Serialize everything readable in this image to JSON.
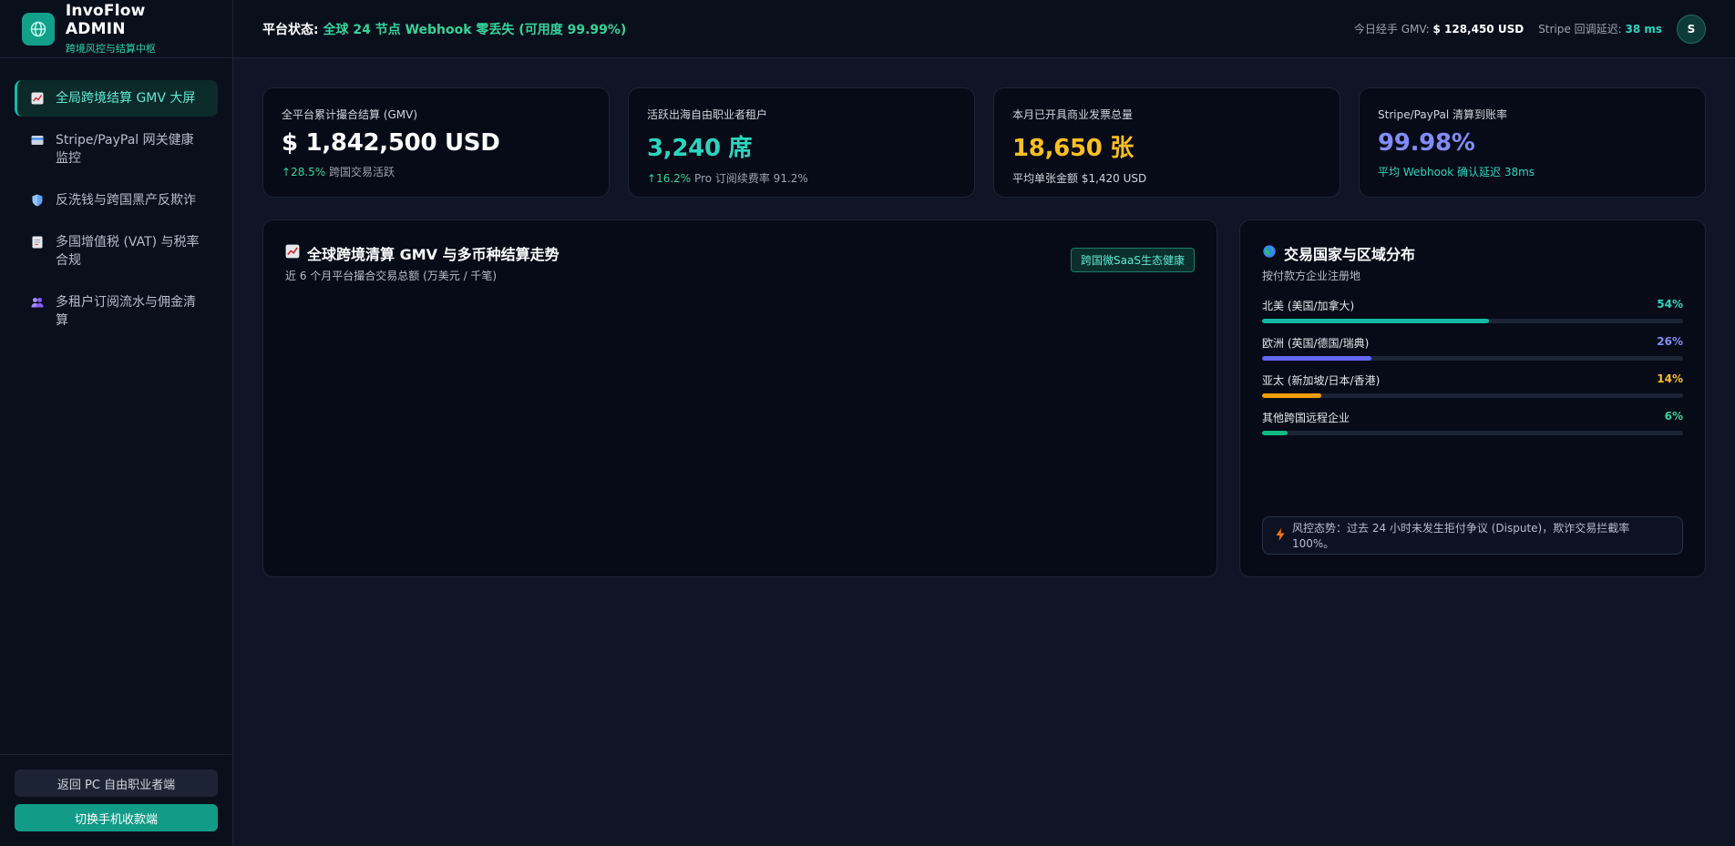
{
  "brand": {
    "name": "InvoFlow ADMIN",
    "subtitle": "跨境风控与结算中枢"
  },
  "nav": {
    "items": [
      {
        "label": "全局跨境结算 GMV 大屏",
        "icon": "chart-icon",
        "active": true
      },
      {
        "label": "Stripe/PayPal 网关健康监控",
        "icon": "card-icon",
        "active": false
      },
      {
        "label": "反洗钱与跨国黑产反欺诈",
        "icon": "shield-icon",
        "active": false
      },
      {
        "label": "多国增值税 (VAT) 与税率合规",
        "icon": "document-icon",
        "active": false
      },
      {
        "label": "多租户订阅流水与佣金清算",
        "icon": "users-icon",
        "active": false
      }
    ]
  },
  "footer": {
    "back_label": "返回 PC 自由职业者端",
    "mobile_label": "切换手机收款端"
  },
  "topbar": {
    "status_label": "平台状态:",
    "status_value": "全球 24 节点 Webhook 零丢失 (可用度 99.99%)",
    "gmv_label": "今日经手 GMV:",
    "gmv_value": "$ 128,450 USD",
    "latency_label": "Stripe 回调延迟:",
    "latency_value": "38 ms",
    "avatar_initial": "S"
  },
  "kpis": [
    {
      "label": "全平台累计撮合结算 (GMV)",
      "value": "$ 1,842,500 USD",
      "trend": "28.5%",
      "note": "跨国交易活跃"
    },
    {
      "label": "活跃出海自由职业者租户",
      "value": "3,240 席",
      "trend": "16.2%",
      "note": "Pro 订阅续费率 91.2%"
    },
    {
      "label": "本月已开具商业发票总量",
      "value": "18,650 张",
      "note": "平均单张金额 $1,420 USD"
    },
    {
      "label": "Stripe/PayPal 清算到账率",
      "value": "99.98%",
      "note": "平均 Webhook 确认延迟 38ms"
    }
  ],
  "chart_panel": {
    "title": "全球跨境清算 GMV 与多币种结算走势",
    "subtitle": "近 6 个月平台撮合交易总额 (万美元 / 千笔)",
    "badge": "跨国微SaaS生态健康"
  },
  "region_panel": {
    "title": "交易国家与区域分布",
    "subtitle": "按付款方企业注册地",
    "regions": [
      {
        "name": "北美 (美国/加拿大)",
        "percent_label": "54%",
        "percent": 54,
        "color": "#14b8a6"
      },
      {
        "name": "欧洲 (英国/德国/瑞典)",
        "percent_label": "26%",
        "percent": 26,
        "color": "#6366f1"
      },
      {
        "name": "亚太 (新加坡/日本/香港)",
        "percent_label": "14%",
        "percent": 14,
        "color": "#f59e0b"
      },
      {
        "name": "其他跨国远程企业",
        "percent_label": "6%",
        "percent": 6,
        "color": "#10b981"
      }
    ],
    "risk_note": "风控态势：过去 24 小时未发生拒付争议 (Dispute)，欺诈交易拦截率 100%。"
  },
  "colors": {
    "accent": "#14b8a6",
    "background": "#0f1525",
    "panel": "#070b17",
    "success": "#34d399",
    "amber": "#fbbf24",
    "indigo": "#818cf8"
  }
}
